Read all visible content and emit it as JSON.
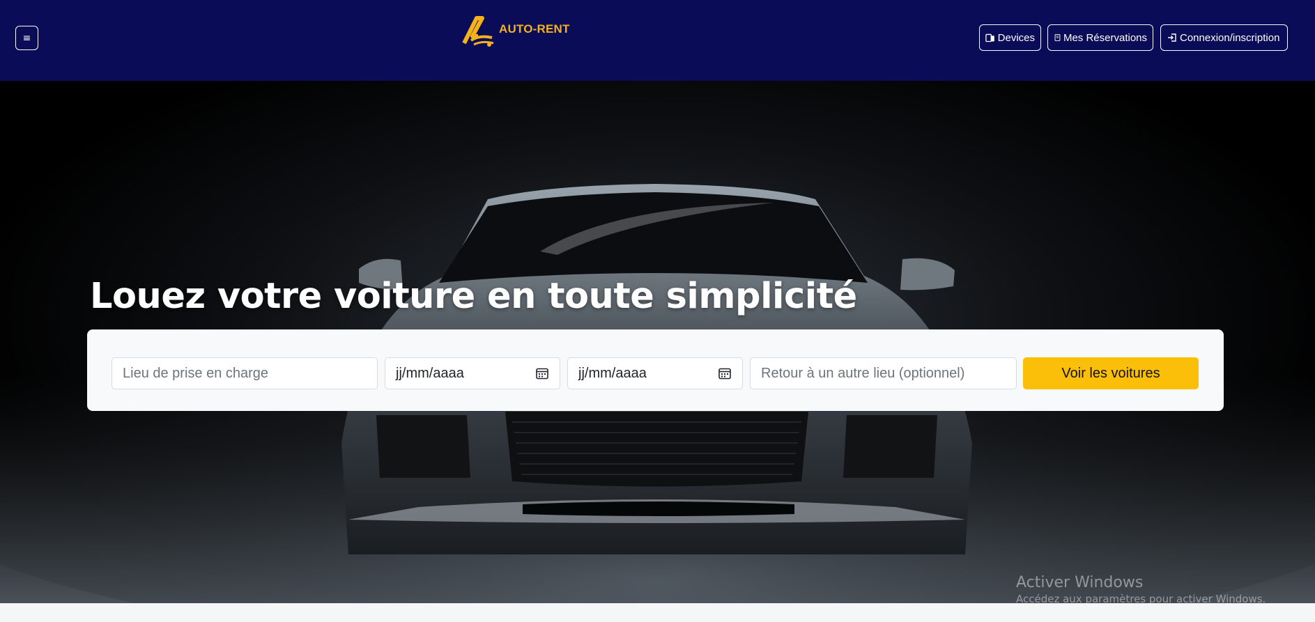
{
  "navbar": {
    "menu_icon": "≡",
    "brand_name": "AUTO-RENT",
    "buttons": {
      "devices": "Devices",
      "reservations": "Mes Réservations",
      "login": "Connexion/inscription"
    },
    "icons": {
      "devices": "devices-icon",
      "reservations": "journal-icon",
      "login": "sign-in-icon"
    }
  },
  "hero": {
    "title": "Louez votre voiture en toute simplicité"
  },
  "search": {
    "pickup_placeholder": "Lieu de prise en charge",
    "date_start": "jj/mm/aaaa",
    "date_end": "jj/mm/aaaa",
    "return_placeholder": "Retour à un autre lieu (optionnel)",
    "submit_label": "Voir les voitures"
  },
  "watermark": {
    "title": "Activer Windows",
    "subtitle": "Accédez aux paramètres pour activer Windows."
  },
  "colors": {
    "navbar_bg": "#0b0c57",
    "brand_accent": "#f6b21a",
    "button_primary": "#fbbf09"
  }
}
